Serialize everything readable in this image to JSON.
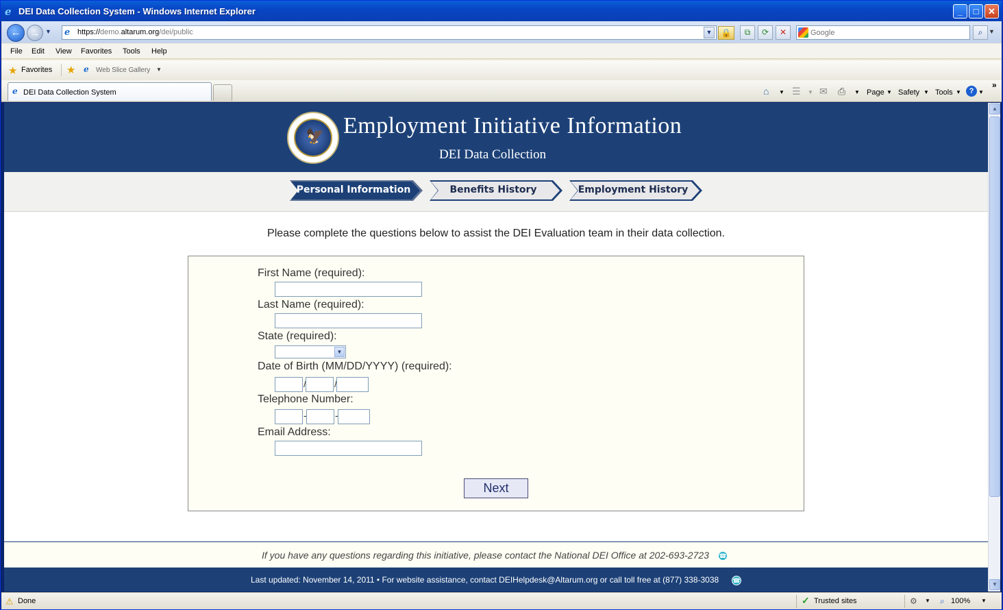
{
  "window": {
    "title": "DEI Data Collection System - Windows Internet Explorer",
    "minimize": "_",
    "maximize": "□",
    "close": "✕"
  },
  "address_bar": {
    "url_scheme": "https://",
    "url_sub": "demo.",
    "url_host": "altarum.org",
    "url_path": "/dei/public",
    "search_placeholder": "Google"
  },
  "menu": [
    "File",
    "Edit",
    "View",
    "Favorites",
    "Tools",
    "Help"
  ],
  "favorites_bar": {
    "favorites_label": "Favorites",
    "web_slice_label": "Web Slice Gallery"
  },
  "tab": {
    "label": "DEI Data Collection System"
  },
  "command_bar": {
    "page": "Page",
    "safety": "Safety",
    "tools": "Tools",
    "help": "?"
  },
  "page": {
    "title": "Employment Initiative Information",
    "subtitle": "DEI Data Collection",
    "steps": [
      {
        "label": "Personal Information",
        "active": true
      },
      {
        "label": "Benefits History",
        "active": false
      },
      {
        "label": "Employment History",
        "active": false
      }
    ],
    "intro": "Please complete the questions below to assist the DEI Evaluation team in their data collection.",
    "form": {
      "first_name_label": "First Name (required):",
      "last_name_label": "Last Name (required):",
      "state_label": "State (required):",
      "dob_label": "Date of Birth (MM/DD/YYYY) (required):",
      "phone_label": "Telephone Number:",
      "email_label": "Email Address:",
      "first_name_value": "",
      "last_name_value": "",
      "state_value": "",
      "email_value": "",
      "dob_separator": "/",
      "phone_separator": "-",
      "next_label": "Next"
    },
    "footer_question": "If you have any questions regarding this initiative, please contact the National DEI Office at 202-693-2723",
    "footer_bar": "Last updated: November 14, 2011 • For website assistance, contact DEIHelpdesk@Altarum.org or call toll free at (877) 338-3038"
  },
  "status_bar": {
    "status": "Done",
    "zone": "Trusted sites",
    "zoom": "100%"
  },
  "colors": {
    "header_blue": "#1d4177",
    "active_step": "#1d4177",
    "inactive_step": "#e8e8ea",
    "form_bg": "#fffef4"
  }
}
